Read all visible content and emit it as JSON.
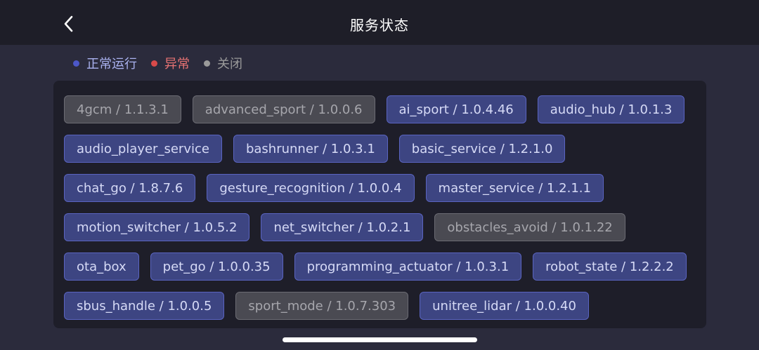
{
  "header": {
    "title": "服务状态",
    "back_icon": "chevron-left-icon"
  },
  "legend": [
    {
      "label": "正常运行",
      "color": "#4c57c8",
      "text_color": "#aab2f0"
    },
    {
      "label": "异常",
      "color": "#d94a4a",
      "text_color": "#e87373"
    },
    {
      "label": "关闭",
      "color": "#9a9a9a",
      "text_color": "#9a9a9a"
    }
  ],
  "colors": {
    "running_bg": "#3d4582",
    "running_border": "#5a64c0",
    "closed_bg": "#4a4a52",
    "closed_border": "#6b6b73"
  },
  "services": [
    {
      "label": "4gcm / 1.1.3.1",
      "status": "closed"
    },
    {
      "label": "advanced_sport / 1.0.0.6",
      "status": "closed"
    },
    {
      "label": "ai_sport / 1.0.4.46",
      "status": "running"
    },
    {
      "label": "audio_hub / 1.0.1.3",
      "status": "running"
    },
    {
      "label": "audio_player_service",
      "status": "running"
    },
    {
      "label": "bashrunner / 1.0.3.1",
      "status": "running"
    },
    {
      "label": "basic_service / 1.2.1.0",
      "status": "running"
    },
    {
      "label": "chat_go / 1.8.7.6",
      "status": "running"
    },
    {
      "label": "gesture_recognition / 1.0.0.4",
      "status": "running"
    },
    {
      "label": "master_service / 1.2.1.1",
      "status": "running"
    },
    {
      "label": "motion_switcher / 1.0.5.2",
      "status": "running"
    },
    {
      "label": "net_switcher / 1.0.2.1",
      "status": "running"
    },
    {
      "label": "obstacles_avoid / 1.0.1.22",
      "status": "closed"
    },
    {
      "label": "ota_box",
      "status": "running"
    },
    {
      "label": "pet_go / 1.0.0.35",
      "status": "running"
    },
    {
      "label": "programming_actuator / 1.0.3.1",
      "status": "running"
    },
    {
      "label": "robot_state / 1.2.2.2",
      "status": "running"
    },
    {
      "label": "sbus_handle / 1.0.0.5",
      "status": "running"
    },
    {
      "label": "sport_mode / 1.0.7.303",
      "status": "closed"
    },
    {
      "label": "unitree_lidar / 1.0.0.40",
      "status": "running"
    }
  ]
}
